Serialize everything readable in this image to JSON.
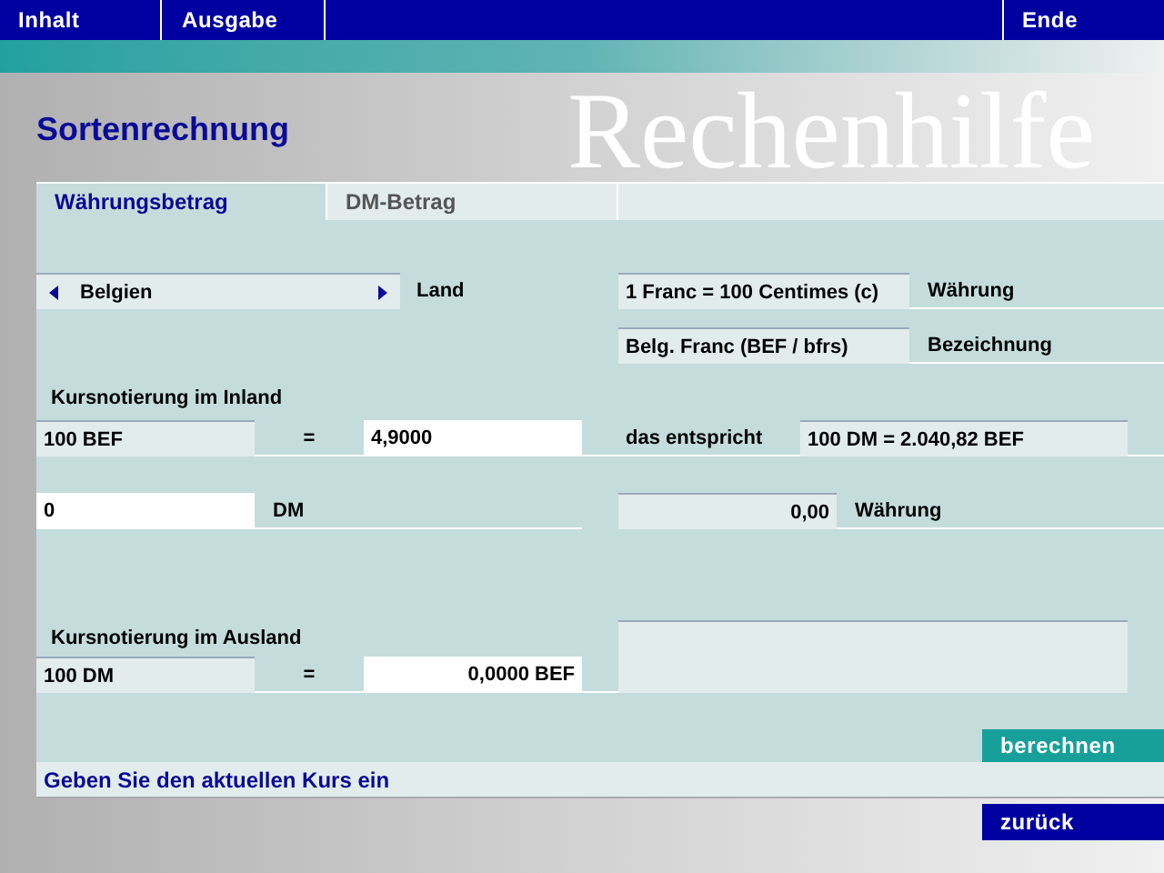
{
  "menu": [
    {
      "label": "Inhalt"
    },
    {
      "label": "Ausgabe"
    }
  ],
  "menu_right": {
    "label": "Ende"
  },
  "page_title": "Sortenrechnung",
  "backdrop_title": "Rechenhilfe",
  "tabs": [
    {
      "label": "Währungsbetrag",
      "selected": true
    },
    {
      "label": "DM-Betrag",
      "selected": false
    }
  ],
  "country": {
    "value": "Belgien",
    "label": "Land"
  },
  "currency": {
    "value": "1 Franc = 100 Centimes (c)",
    "label": "Währung"
  },
  "designation": {
    "value": "Belg. Franc (BEF / bfrs)",
    "label": "Bezeichnung"
  },
  "inland": {
    "heading": "Kursnotierung im Inland",
    "base": "100 BEF",
    "equals": "=",
    "rate": "4,9000",
    "note_label": "das entspricht",
    "note_value": "100 DM = 2.040,82 BEF"
  },
  "amount": {
    "value": "0",
    "unit": "DM",
    "result": "0,00",
    "result_label": "Währung"
  },
  "ausland": {
    "heading": "Kursnotierung im Ausland",
    "base": "100 DM",
    "equals": "=",
    "rate": "0,0000 BEF"
  },
  "buttons": {
    "calculate": "berechnen",
    "back": "zurück"
  },
  "status_bar": "Geben Sie den aktuellen Kurs ein"
}
